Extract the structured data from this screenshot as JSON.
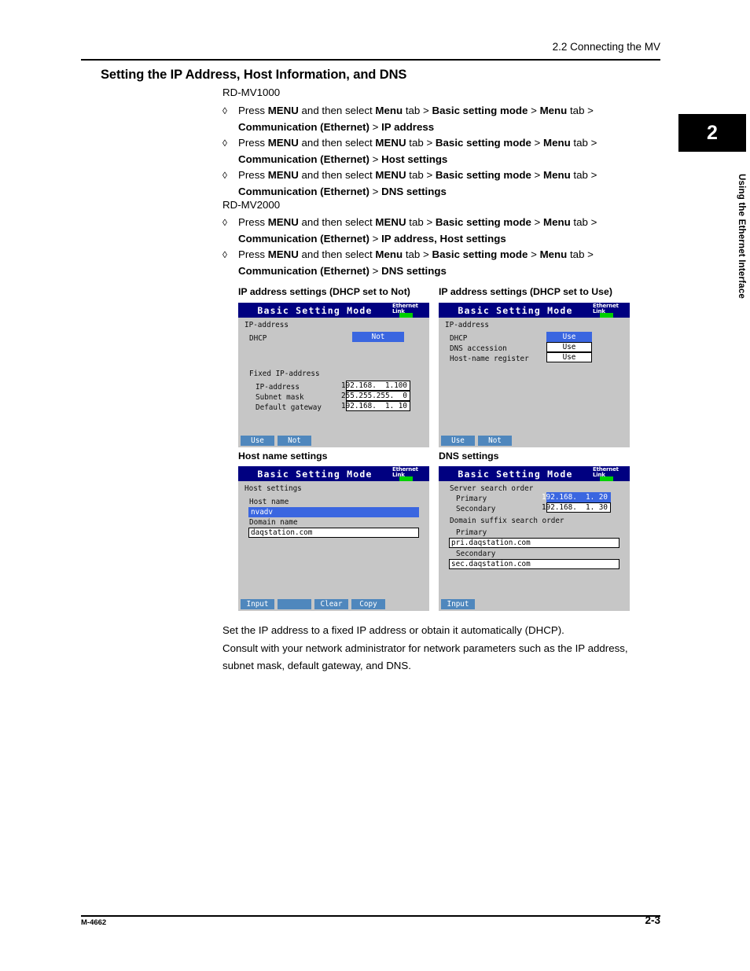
{
  "header": {
    "running_head": "2.2  Connecting the MV"
  },
  "chapter_tab": {
    "number": "2",
    "label": "Using the Ethernet Interface"
  },
  "section": {
    "title": "Setting the IP Address, Host Information, and DNS"
  },
  "models": [
    {
      "name": "RD-MV1000",
      "bullets": [
        {
          "line1_pre": "Press ",
          "line1_b1": "MENU",
          "line1_mid1": " and then select ",
          "line1_b2": "Menu",
          "line1_mid2": " tab > ",
          "line1_b3": "Basic setting mode",
          "line1_mid3": " > ",
          "line1_b4": "Menu",
          "line1_end": " tab >",
          "line2_b1": "Communication (Ethernet)",
          "line2_mid": " > ",
          "line2_b2": "IP address"
        },
        {
          "line1_pre": "Press ",
          "line1_b1": "MENU",
          "line1_mid1": " and then select ",
          "line1_b2": "MENU",
          "line1_mid2": " tab > ",
          "line1_b3": "Basic setting mode",
          "line1_mid3": " > ",
          "line1_b4": "Menu",
          "line1_end": " tab >",
          "line2_b1": "Communication (Ethernet)",
          "line2_mid": " > ",
          "line2_b2": "Host settings"
        },
        {
          "line1_pre": "Press ",
          "line1_b1": "MENU",
          "line1_mid1": " and then select ",
          "line1_b2": "MENU",
          "line1_mid2": " tab > ",
          "line1_b3": "Basic setting mode",
          "line1_mid3": " > ",
          "line1_b4": "Menu",
          "line1_end": " tab >",
          "line2_b1": "Communication (Ethernet)",
          "line2_mid": " > ",
          "line2_b2": "DNS settings"
        }
      ]
    },
    {
      "name": "RD-MV2000",
      "bullets": [
        {
          "line1_pre": "Press ",
          "line1_b1": "MENU",
          "line1_mid1": " and then select ",
          "line1_b2": "MENU",
          "line1_mid2": " tab > ",
          "line1_b3": "Basic setting mode",
          "line1_mid3": " > ",
          "line1_b4": "Menu",
          "line1_end": " tab >",
          "line2_b1": "Communication (Ethernet)",
          "line2_mid": " > ",
          "line2_b2": "IP address, Host settings"
        },
        {
          "line1_pre": "Press ",
          "line1_b1": "MENU",
          "line1_mid1": " and then select ",
          "line1_b2": "Menu",
          "line1_mid2": " tab > ",
          "line1_b3": "Basic setting mode",
          "line1_mid3": " > ",
          "line1_b4": "Menu",
          "line1_end": " tab >",
          "line2_b1": "Communication (Ethernet)",
          "line2_mid": " > ",
          "line2_b2": "DNS settings"
        }
      ]
    }
  ],
  "bullet_glyph": "◊",
  "captions": {
    "ip_not": "IP address settings (DHCP set to Not)",
    "ip_use": "IP address settings (DHCP set to Use)",
    "host": "Host name settings",
    "dns": "DNS settings"
  },
  "lcd_common": {
    "title": "Basic Setting Mode",
    "eth_line1": "Ethernet",
    "eth_line2": "Link"
  },
  "panel_ip_not": {
    "heading": "IP-address",
    "dhcp_label": "DHCP",
    "dhcp_value": "Not",
    "fixed_heading": "Fixed IP-address",
    "rows": [
      {
        "label": "IP-address",
        "value": "192.168.  1.100"
      },
      {
        "label": "Subnet mask",
        "value": "255.255.255.  0"
      },
      {
        "label": "Default gateway",
        "value": "192.168.  1. 10"
      }
    ],
    "keys": [
      "Use",
      "Not"
    ]
  },
  "panel_ip_use": {
    "heading": "IP-address",
    "rows": [
      {
        "label": "DHCP",
        "value": "Use",
        "selected": true
      },
      {
        "label": "DNS accession",
        "value": "Use",
        "selected": false
      },
      {
        "label": "Host-name register",
        "value": "Use",
        "selected": false
      }
    ],
    "keys": [
      "Use",
      "Not"
    ]
  },
  "panel_host": {
    "heading": "Host settings",
    "host_label": "Host name",
    "host_value": "nvadv",
    "domain_label": "Domain name",
    "domain_value": "daqstation.com",
    "keys": [
      "Input",
      "",
      "Clear",
      "Copy"
    ]
  },
  "panel_dns": {
    "server_heading": "Server search order",
    "primary_label": "Primary",
    "primary_value": "192.168.  1. 20",
    "secondary_label": "Secondary",
    "secondary_value": "192.168.  1. 30",
    "suffix_heading": "Domain suffix search order",
    "suffix_primary_label": "Primary",
    "suffix_primary_value": "pri.daqstation.com",
    "suffix_secondary_label": "Secondary",
    "suffix_secondary_value": "sec.daqstation.com",
    "keys": [
      "Input"
    ]
  },
  "tail": {
    "line1": "Set the IP address to a fixed IP address or obtain it automatically (DHCP).",
    "line2": "Consult with your network administrator for network parameters such as the IP address,",
    "line3": "subnet mask, default gateway, and DNS."
  },
  "footer": {
    "doc_number": "M-4662",
    "page_number": "2-3"
  }
}
